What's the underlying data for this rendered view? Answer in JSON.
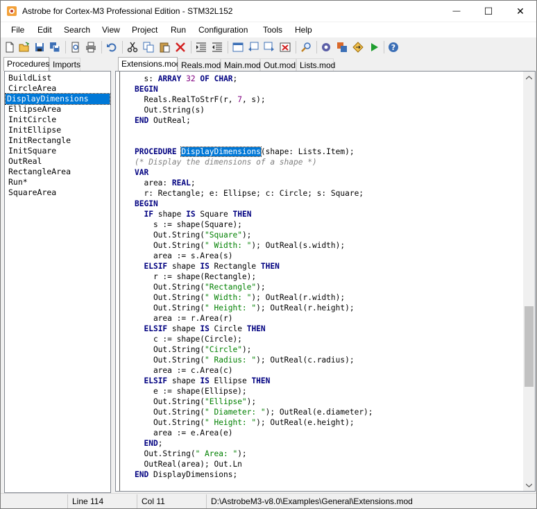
{
  "window": {
    "title": "Astrobe for Cortex-M3 Professional Edition - STM32L152",
    "minimize_glyph": "—",
    "maximize_glyph": "☐",
    "close_glyph": "✕"
  },
  "menu": [
    "File",
    "Edit",
    "Search",
    "View",
    "Project",
    "Run",
    "Configuration",
    "Tools",
    "Help"
  ],
  "toolbar_icons": [
    "new-file-icon",
    "open-folder-icon",
    "save-icon",
    "save-all-icon",
    "print-preview-icon",
    "print-icon",
    "undo-icon",
    "cut-icon",
    "copy-icon",
    "paste-icon",
    "delete-icon",
    "indent-icon",
    "outdent-icon",
    "window-icon",
    "back-icon",
    "forward-icon",
    "close-window-icon",
    "find-icon",
    "gear-icon",
    "build-icon",
    "link-icon",
    "run-icon",
    "help-icon"
  ],
  "left_panel": {
    "tabs": [
      "Procedures",
      "Imports"
    ],
    "items": [
      "BuildList",
      "CircleArea",
      "DisplayDimensions",
      "EllipseArea",
      "InitCircle",
      "InitEllipse",
      "InitRectangle",
      "InitSquare",
      "OutReal",
      "RectangleArea",
      "Run*",
      "SquareArea"
    ],
    "selected": "DisplayDimensions"
  },
  "editor": {
    "tabs": [
      "Extensions.mod",
      "Reals.mod",
      "Main.mod",
      "Out.mod",
      "Lists.mod"
    ],
    "active_tab": "Extensions.mod",
    "lines": [
      [
        [
          "  s: ",
          ""
        ],
        [
          "ARRAY",
          "kw"
        ],
        [
          " ",
          ""
        ],
        [
          "32",
          "num"
        ],
        [
          " ",
          ""
        ],
        [
          "OF",
          "kw"
        ],
        [
          " ",
          ""
        ],
        [
          "CHAR",
          "kw"
        ],
        [
          ";",
          ""
        ]
      ],
      [
        [
          "BEGIN",
          "kw"
        ]
      ],
      [
        [
          "  Reals.RealToStrF(r, ",
          ""
        ],
        [
          "7",
          "num"
        ],
        [
          ", s);",
          ""
        ]
      ],
      [
        [
          "  Out.String(s)",
          ""
        ]
      ],
      [
        [
          "END",
          "kw"
        ],
        [
          " OutReal;",
          ""
        ]
      ],
      [],
      [],
      [
        [
          "PROCEDURE",
          "kw"
        ],
        [
          " ",
          ""
        ],
        [
          "DisplayDimensions",
          "hl"
        ],
        [
          "(shape: Lists.Item);",
          ""
        ]
      ],
      [
        [
          "(* Display the dimensions of a shape *)",
          "cm"
        ]
      ],
      [
        [
          "VAR",
          "kw"
        ]
      ],
      [
        [
          "  area: ",
          ""
        ],
        [
          "REAL",
          "kw"
        ],
        [
          ";",
          ""
        ]
      ],
      [
        [
          "  r: Rectangle; e: Ellipse; c: Circle; s: Square;",
          ""
        ]
      ],
      [
        [
          "BEGIN",
          "kw"
        ]
      ],
      [
        [
          "  ",
          ""
        ],
        [
          "IF",
          "kw"
        ],
        [
          " shape ",
          ""
        ],
        [
          "IS",
          "kw"
        ],
        [
          " Square ",
          ""
        ],
        [
          "THEN",
          "kw"
        ]
      ],
      [
        [
          "    s := shape(Square);",
          ""
        ]
      ],
      [
        [
          "    Out.String(",
          ""
        ],
        [
          "\"Square\"",
          "st"
        ],
        [
          ");",
          ""
        ]
      ],
      [
        [
          "    Out.String(",
          ""
        ],
        [
          "\" Width: \"",
          "st"
        ],
        [
          "); OutReal(s.width);",
          ""
        ]
      ],
      [
        [
          "    area := s.Area(s)",
          ""
        ]
      ],
      [
        [
          "  ",
          ""
        ],
        [
          "ELSIF",
          "kw"
        ],
        [
          " shape ",
          ""
        ],
        [
          "IS",
          "kw"
        ],
        [
          " Rectangle ",
          ""
        ],
        [
          "THEN",
          "kw"
        ]
      ],
      [
        [
          "    r := shape(Rectangle);",
          ""
        ]
      ],
      [
        [
          "    Out.String(",
          ""
        ],
        [
          "\"Rectangle\"",
          "st"
        ],
        [
          ");",
          ""
        ]
      ],
      [
        [
          "    Out.String(",
          ""
        ],
        [
          "\" Width: \"",
          "st"
        ],
        [
          "); OutReal(r.width);",
          ""
        ]
      ],
      [
        [
          "    Out.String(",
          ""
        ],
        [
          "\" Height: \"",
          "st"
        ],
        [
          "); OutReal(r.height);",
          ""
        ]
      ],
      [
        [
          "    area := r.Area(r)",
          ""
        ]
      ],
      [
        [
          "  ",
          ""
        ],
        [
          "ELSIF",
          "kw"
        ],
        [
          " shape ",
          ""
        ],
        [
          "IS",
          "kw"
        ],
        [
          " Circle ",
          ""
        ],
        [
          "THEN",
          "kw"
        ]
      ],
      [
        [
          "    c := shape(Circle);",
          ""
        ]
      ],
      [
        [
          "    Out.String(",
          ""
        ],
        [
          "\"Circle\"",
          "st"
        ],
        [
          ");",
          ""
        ]
      ],
      [
        [
          "    Out.String(",
          ""
        ],
        [
          "\" Radius: \"",
          "st"
        ],
        [
          "); OutReal(c.radius);",
          ""
        ]
      ],
      [
        [
          "    area := c.Area(c)",
          ""
        ]
      ],
      [
        [
          "  ",
          ""
        ],
        [
          "ELSIF",
          "kw"
        ],
        [
          " shape ",
          ""
        ],
        [
          "IS",
          "kw"
        ],
        [
          " Ellipse ",
          ""
        ],
        [
          "THEN",
          "kw"
        ]
      ],
      [
        [
          "    e := shape(Ellipse);",
          ""
        ]
      ],
      [
        [
          "    Out.String(",
          ""
        ],
        [
          "\"Ellipse\"",
          "st"
        ],
        [
          ");",
          ""
        ]
      ],
      [
        [
          "    Out.String(",
          ""
        ],
        [
          "\" Diameter: \"",
          "st"
        ],
        [
          "); OutReal(e.diameter);",
          ""
        ]
      ],
      [
        [
          "    Out.String(",
          ""
        ],
        [
          "\" Height: \"",
          "st"
        ],
        [
          "); OutReal(e.height);",
          ""
        ]
      ],
      [
        [
          "    area := e.Area(e)",
          ""
        ]
      ],
      [
        [
          "  ",
          ""
        ],
        [
          "END",
          "kw"
        ],
        [
          ";",
          ""
        ]
      ],
      [
        [
          "  Out.String(",
          ""
        ],
        [
          "\" Area: \"",
          "st"
        ],
        [
          ");",
          ""
        ]
      ],
      [
        [
          "  OutReal(area); Out.Ln",
          ""
        ]
      ],
      [
        [
          "END",
          "kw"
        ],
        [
          " DisplayDimensions;",
          ""
        ]
      ]
    ]
  },
  "status": {
    "line": "Line 114",
    "col": "Col 11",
    "path": "D:\\AstrobeM3-v8.0\\Examples\\General\\Extensions.mod"
  },
  "colors": {
    "keyword": "#000080",
    "string": "#008000",
    "number": "#800080",
    "comment": "#808080",
    "selection": "#0078d7"
  }
}
